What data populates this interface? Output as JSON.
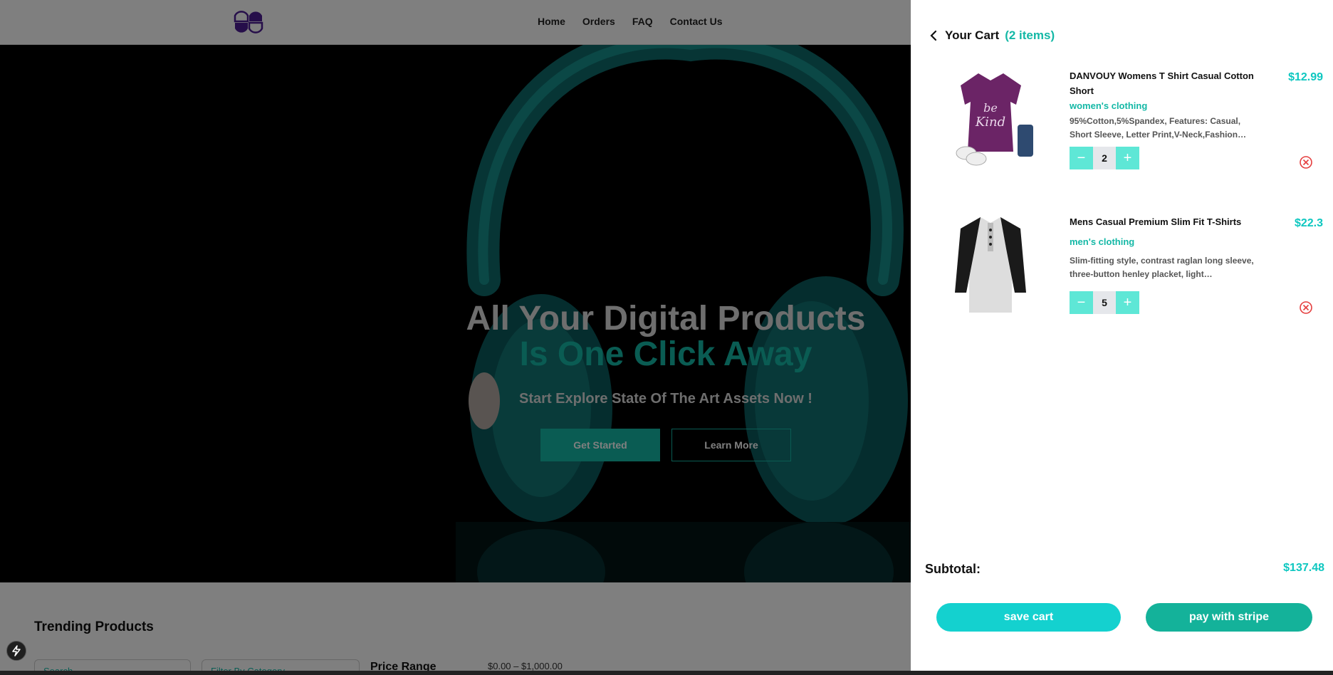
{
  "nav": {
    "links": [
      "Home",
      "Orders",
      "FAQ",
      "Contact Us"
    ]
  },
  "hero": {
    "title_line1": "All Your Digital Products",
    "title_line2": "Is One Click Away",
    "subtitle": "Start Explore State Of The Art Assets Now !",
    "primary_button": "Get Started",
    "secondary_button": "Learn More"
  },
  "trending": {
    "title": "Trending Products",
    "search_placeholder": "Search",
    "category_placeholder": "Filter By Category",
    "price_label": "Price Range",
    "price_range": "$0.00 – $1,000.00"
  },
  "cart": {
    "title": "Your Cart",
    "count_label": "(2 items)",
    "items": [
      {
        "title": "DANVOUY Womens T Shirt Casual Cotton Short",
        "category": "women's clothing",
        "description": "95%Cotton,5%Spandex, Features: Casual, Short Sleeve, Letter Print,V-Neck,Fashion…",
        "quantity": "2",
        "price": "$12.99"
      },
      {
        "title": "Mens Casual Premium Slim Fit T-Shirts",
        "category": "men's clothing",
        "description": "Slim-fitting style, contrast raglan long sleeve, three-button henley placket, light…",
        "quantity": "5",
        "price": "$22.3"
      }
    ],
    "subtotal_label": "Subtotal:",
    "subtotal_value": "$137.48",
    "save_button": "save cart",
    "pay_button": "pay with stripe"
  },
  "colors": {
    "accent": "#14b8a6",
    "price": "#0ec7c0",
    "remove": "#e53e3e",
    "logo": "#4c1d95"
  }
}
